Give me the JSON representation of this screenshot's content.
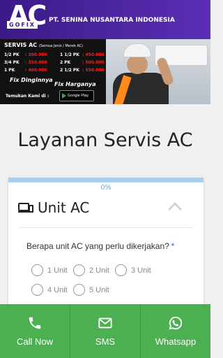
{
  "banner": {
    "logo_text": "AC",
    "logo_sub": "GOFIX",
    "company": "PT. SENINA NUSANTARA INDONESIA",
    "service_title": "SERVIS AC",
    "service_note": "(Semua Jenis / Merek AC)",
    "prices_left": [
      {
        "pk": "1/2 PK",
        "price": ": 300.000"
      },
      {
        "pk": "3/4 PK",
        "price": ": 350.000"
      },
      {
        "pk": "1 PK",
        "price": ": 400.000"
      }
    ],
    "prices_right": [
      {
        "pk": "1 1/2 PK",
        "price": ": 450.000"
      },
      {
        "pk": "2 PK",
        "price": ": 500.000"
      },
      {
        "pk": "2 1/2 PK",
        "price": ": 550.000"
      }
    ],
    "slogan_1": "Fix Dinginnya",
    "slogan_2": "Fix Harganya",
    "find_us": "Temukan Kami di :",
    "store_badge": "Google Play"
  },
  "page": {
    "title": "Layanan Servis AC"
  },
  "form": {
    "progress_label": "0%",
    "progress_value": 0,
    "section_title": "Unit AC",
    "question": "Berapa unit AC yang perlu dikerjakan?",
    "required_mark": "*",
    "options": [
      "1 Unit",
      "2 Unit",
      "3 Unit",
      "4 Unit",
      "5 Unit"
    ]
  },
  "bottom_bar": {
    "call_label": "Call Now",
    "sms_label": "SMS",
    "whatsapp_label": "Whatsapp"
  },
  "colors": {
    "brand_purple": "#4a23a0",
    "action_green": "#4caf50",
    "progress_blue": "#a9cff0",
    "required_blue": "#1e6fd9"
  }
}
